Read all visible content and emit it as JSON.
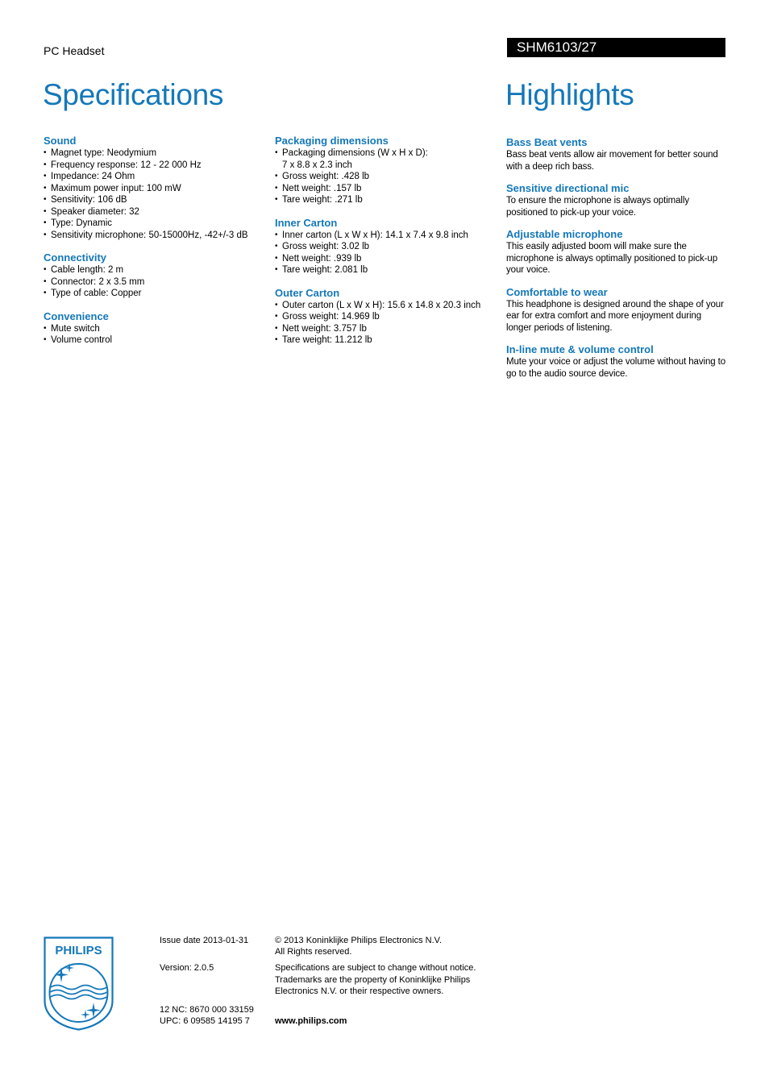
{
  "header": {
    "product_type": "PC Headset",
    "model": "SHM6103/27"
  },
  "titles": {
    "specifications": "Specifications",
    "highlights": "Highlights"
  },
  "specs": {
    "col1": [
      {
        "title": "Sound",
        "items": [
          "Magnet type: Neodymium",
          "Frequency response: 12 - 22 000 Hz",
          "Impedance: 24 Ohm",
          "Maximum power input: 100 mW",
          "Sensitivity: 106 dB",
          "Speaker diameter: 32",
          "Type: Dynamic",
          "Sensitivity microphone: 50-15000Hz, -42+/-3 dB"
        ]
      },
      {
        "title": "Connectivity",
        "items": [
          "Cable length: 2 m",
          "Connector: 2 x 3.5 mm",
          "Type of cable: Copper"
        ]
      },
      {
        "title": "Convenience",
        "items": [
          "Mute switch",
          "Volume control"
        ]
      }
    ],
    "col2": [
      {
        "title": "Packaging dimensions",
        "items": [
          "Packaging dimensions (W x H x D):",
          "Gross weight: .428 lb",
          "Nett weight: .157 lb",
          "Tare weight: .271 lb"
        ],
        "continuation": "7 x 8.8 x 2.3 inch"
      },
      {
        "title": "Inner Carton",
        "items": [
          "Inner carton (L x W x H): 14.1 x 7.4 x 9.8 inch",
          "Gross weight: 3.02 lb",
          "Nett weight: .939 lb",
          "Tare weight: 2.081 lb"
        ]
      },
      {
        "title": "Outer Carton",
        "items": [
          "Outer carton (L x W x H): 15.6 x 14.8 x 20.3 inch",
          "Gross weight: 14.969 lb",
          "Nett weight: 3.757 lb",
          "Tare weight: 11.212 lb"
        ]
      }
    ]
  },
  "highlights": [
    {
      "title": "Bass Beat vents",
      "text": "Bass beat vents allow air movement for better sound with a deep rich bass."
    },
    {
      "title": "Sensitive directional mic",
      "text": "To ensure the microphone is always optimally positioned to pick-up your voice."
    },
    {
      "title": "Adjustable microphone",
      "text": "This easily adjusted boom will make sure the microphone is always optimally positioned to pick-up your voice."
    },
    {
      "title": "Comfortable to wear",
      "text": "This headphone is designed around the shape of your ear for extra comfort and more enjoyment during longer periods of listening."
    },
    {
      "title": "In-line mute & volume control",
      "text": "Mute your voice or adjust the volume without having to go to the audio source device."
    }
  ],
  "footer": {
    "logo_text": "PHILIPS",
    "issue_date": "Issue date 2013-01-31",
    "version": "Version: 2.0.5",
    "nc": "12 NC: 8670 000 33159",
    "upc": "UPC: 6 09585 14195 7",
    "copyright": "© 2013 Koninklijke Philips Electronics N.V.",
    "rights": "All Rights reserved.",
    "disclaimer": "Specifications are subject to change without notice. Trademarks are the property of Koninklijke Philips Electronics N.V. or their respective owners.",
    "website": "www.philips.com"
  },
  "colors": {
    "brand_blue": "#1478b9",
    "model_bar_bg": "#000000"
  }
}
